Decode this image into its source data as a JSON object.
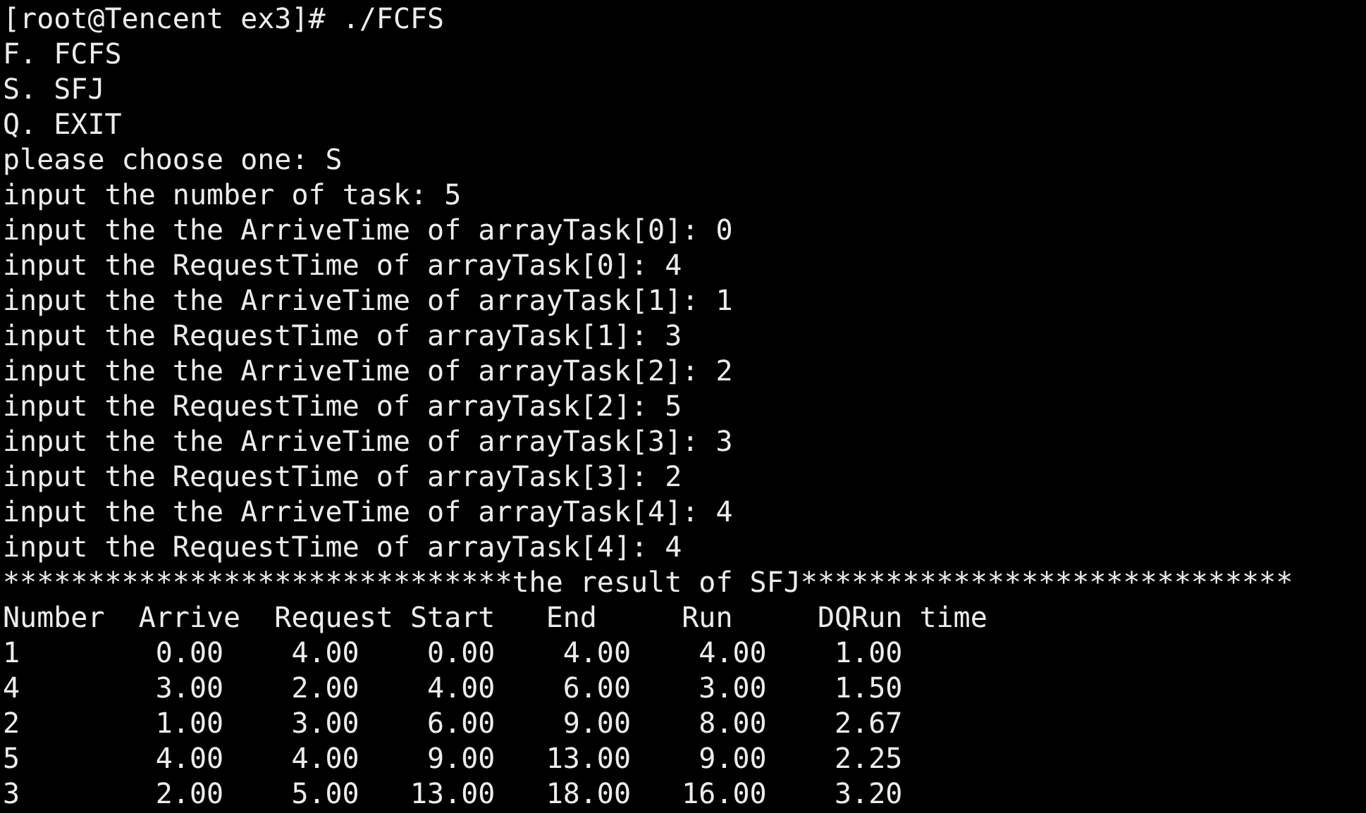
{
  "terminal": {
    "lines": [
      "[root@Tencent ex3]# ./FCFS",
      "F. FCFS",
      "S. SFJ",
      "Q. EXIT",
      "please choose one: S",
      "input the number of task: 5",
      "input the the ArriveTime of arrayTask[0]: 0",
      "input the RequestTime of arrayTask[0]: 4",
      "input the the ArriveTime of arrayTask[1]: 1",
      "input the RequestTime of arrayTask[1]: 3",
      "input the the ArriveTime of arrayTask[2]: 2",
      "input the RequestTime of arrayTask[2]: 5",
      "input the the ArriveTime of arrayTask[3]: 3",
      "input the RequestTime of arrayTask[3]: 2",
      "input the the ArriveTime of arrayTask[4]: 4",
      "input the RequestTime of arrayTask[4]: 4",
      "******************************the result of SFJ*****************************"
    ],
    "table": {
      "columns": [
        "Number",
        "Arrive",
        "Request",
        "Start",
        "End",
        "Run",
        "DQRun time"
      ],
      "rows": [
        [
          "1",
          "0.00",
          "4.00",
          "0.00",
          "4.00",
          "4.00",
          "1.00"
        ],
        [
          "4",
          "3.00",
          "2.00",
          "4.00",
          "6.00",
          "3.00",
          "1.50"
        ],
        [
          "2",
          "1.00",
          "3.00",
          "6.00",
          "9.00",
          "8.00",
          "2.67"
        ],
        [
          "5",
          "4.00",
          "4.00",
          "9.00",
          "13.00",
          "9.00",
          "2.25"
        ],
        [
          "3",
          "2.00",
          "5.00",
          "13.00",
          "18.00",
          "16.00",
          "3.20"
        ]
      ]
    }
  }
}
